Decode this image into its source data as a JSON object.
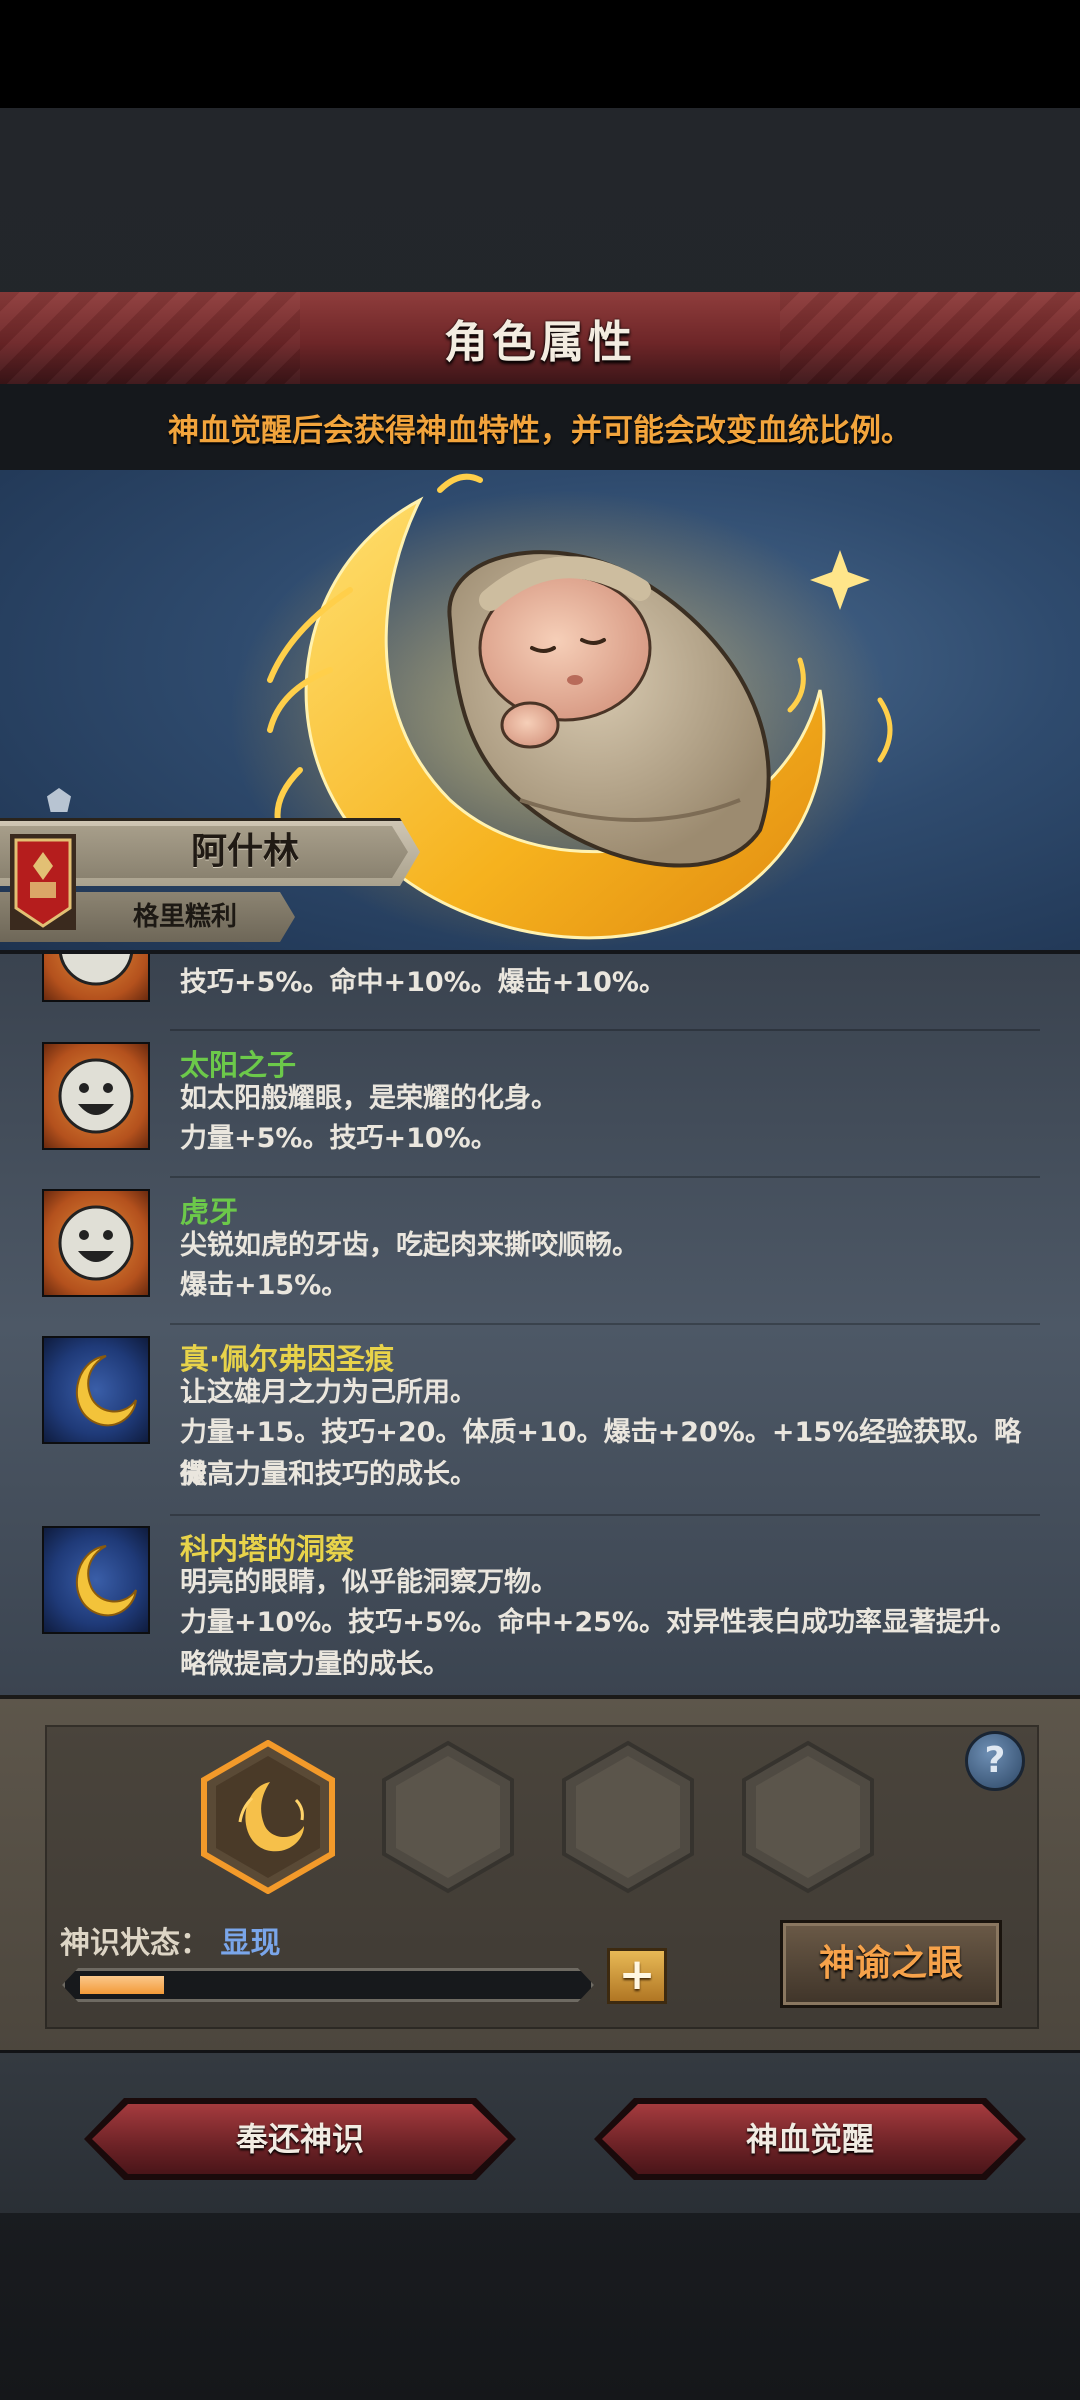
{
  "header": {
    "title": "角色属性"
  },
  "notice": "神血觉醒后会获得神血特性，并可能会改变血统比例。",
  "character": {
    "name": "阿什林",
    "family": "格里糕利"
  },
  "traits": [
    {
      "name": "",
      "icon": "sun-face-icon",
      "description": "",
      "effect": "技巧+5%。命中+10%。爆击+10%。",
      "name_color": "#7fd14a"
    },
    {
      "name": "太阳之子",
      "icon": "sun-face-icon",
      "description": "如太阳般耀眼，是荣耀的化身。",
      "effect": "力量+5%。技巧+10%。",
      "name_color": "#6cc94a"
    },
    {
      "name": "虎牙",
      "icon": "sun-face-icon",
      "description": "尖锐如虎的牙齿，吃起肉来撕咬顺畅。",
      "effect": "爆击+15%。",
      "name_color": "#6cc94a"
    },
    {
      "name": "真·佩尔弗因圣痕",
      "icon": "crescent-moon-icon",
      "description": "让这雄月之力为己所用。",
      "effect": "力量+15。技巧+20。体质+10。爆击+20%。+15%经验获取。略微",
      "effect2": "提高力量和技巧的成长。",
      "name_color": "#e8d34a"
    },
    {
      "name": "科内塔的洞察",
      "icon": "crescent-moon-icon",
      "description": "明亮的眼睛，似乎能洞察万物。",
      "effect": "力量+10%。技巧+5%。命中+25%。对异性表白成功率显著提升。",
      "effect2": "略微提高力量的成长。",
      "name_color": "#e8d34a"
    }
  ],
  "awakening": {
    "state_label": "神识状态：",
    "state_value": "显现",
    "progress": 0.17,
    "plus_label": "+",
    "oracle_button": "神谕之眼",
    "help_label": "?"
  },
  "footer": {
    "return_button": "奉还神识",
    "awaken_button": "神血觉醒"
  },
  "colors": {
    "accent_orange": "#f2a43c",
    "state_blue": "#7aa6ea",
    "title_red": "#6e2628"
  }
}
